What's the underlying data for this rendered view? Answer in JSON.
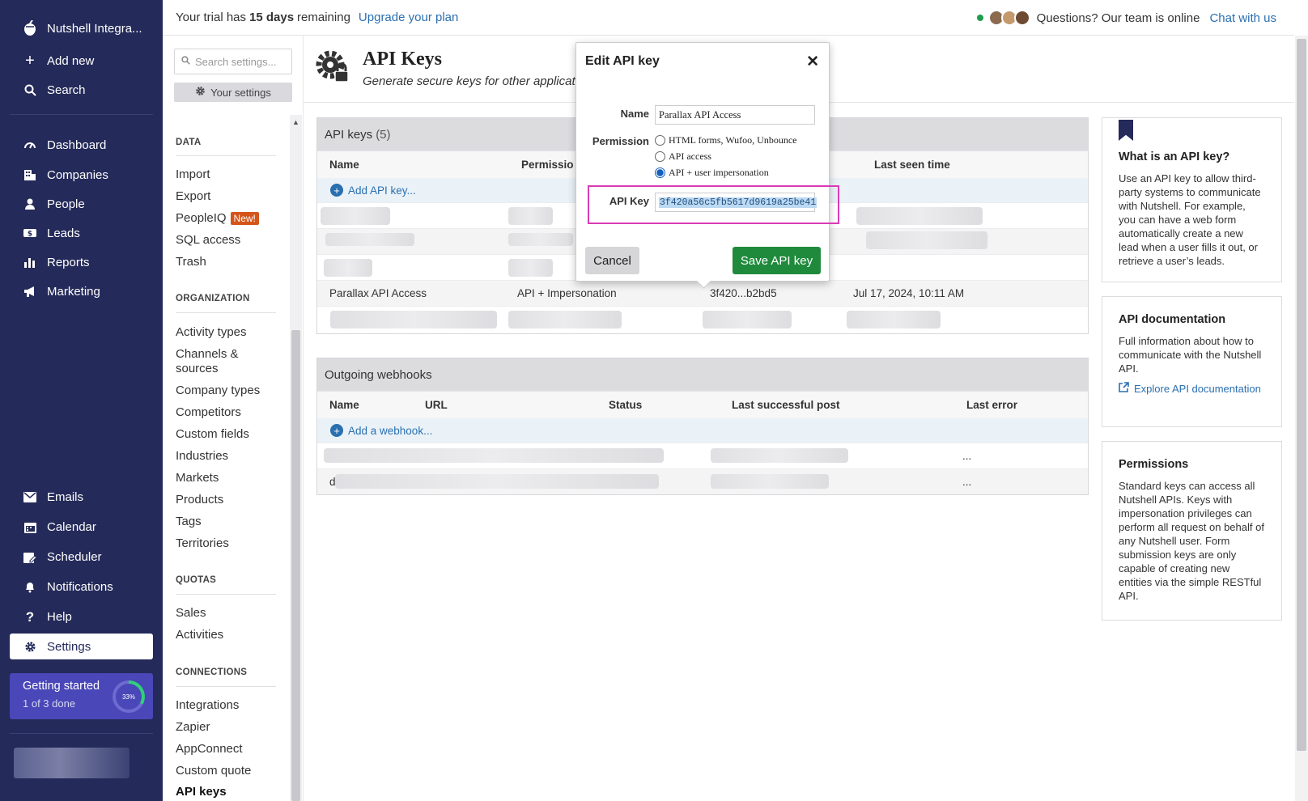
{
  "app": {
    "workspace_name": "Nutshell Integra..."
  },
  "nav": {
    "add_new": "Add new",
    "search": "Search",
    "dashboard": "Dashboard",
    "companies": "Companies",
    "people": "People",
    "leads": "Leads",
    "reports": "Reports",
    "marketing": "Marketing",
    "emails": "Emails",
    "calendar": "Calendar",
    "scheduler": "Scheduler",
    "notifications": "Notifications",
    "help": "Help",
    "settings": "Settings"
  },
  "getting_started": {
    "title": "Getting started",
    "progress_text": "1 of 3 done",
    "percent_label": "33%",
    "percent": 33
  },
  "topbar": {
    "trial_prefix": "Your trial has",
    "trial_days": "15 days",
    "trial_suffix": "remaining",
    "upgrade_link": "Upgrade your plan",
    "support_text": "Questions? Our team is online",
    "chat_link": "Chat with us"
  },
  "settings_sidebar": {
    "search_placeholder": "Search settings...",
    "your_settings": "Your settings",
    "data_heading": "DATA",
    "data_items": [
      "Import",
      "Export",
      "PeopleIQ",
      "SQL access",
      "Trash"
    ],
    "new_badge": "New!",
    "org_heading": "ORGANIZATION",
    "org_items": [
      "Activity types",
      "Channels &",
      "sources",
      "Company types",
      "Competitors",
      "Custom fields",
      "Industries",
      "Markets",
      "Products",
      "Tags",
      "Territories"
    ],
    "quotas_heading": "QUOTAS",
    "quotas_items": [
      "Sales",
      "Activities"
    ],
    "connections_heading": "CONNECTIONS",
    "connections_items": [
      "Integrations",
      "Zapier",
      "AppConnect",
      "Custom quote",
      "API keys"
    ]
  },
  "page": {
    "title": "API Keys",
    "subtitle": "Generate secure keys for other applications"
  },
  "api_keys_panel": {
    "title": "API keys",
    "count": "(5)",
    "columns": {
      "name": "Name",
      "permission": "Permissio",
      "last_seen": "Last seen time"
    },
    "add_label": "Add API key...",
    "row": {
      "name": "Parallax API Access",
      "permission": "API + Impersonation",
      "key": "3f420...b2bd5",
      "last_seen": "Jul 17, 2024, 10:11 AM"
    }
  },
  "webhooks_panel": {
    "title": "Outgoing webhooks",
    "columns": {
      "name": "Name",
      "url": "URL",
      "status": "Status",
      "last_post": "Last successful post",
      "last_error": "Last error"
    },
    "add_label": "Add a webhook...",
    "row1_error": "...",
    "row2_name": "d",
    "row2_error": "..."
  },
  "aside": {
    "what_title": "What is an API key?",
    "what_body": "Use an API key to allow third-party systems to communicate with Nutshell. For example, you can have a web form automatically create a new lead when a user fills it out, or retrieve a user’s leads.",
    "doc_title": "API documentation",
    "doc_body": "Full information about how to communicate with the Nutshell API.",
    "doc_link": "Explore API documentation",
    "perm_title": "Permissions",
    "perm_body": "Standard keys can access all Nutshell APIs. Keys with impersonation privileges can perform all request on behalf of any Nutshell user. Form submission keys are only capable of creating new entities via the simple RESTful API."
  },
  "modal": {
    "title": "Edit API key",
    "name_label": "Name",
    "name_value": "Parallax API Access",
    "permission_label": "Permission",
    "options": [
      "HTML forms, Wufoo, Unbounce",
      "API access",
      "API + user impersonation"
    ],
    "selected_option": "API + user impersonation",
    "key_label": "API Key",
    "key_value": "3f420a56c5fb5617d9619a25be41",
    "cancel": "Cancel",
    "save": "Save API key"
  },
  "colors": {
    "nav_bg": "#242a59",
    "accent_link": "#2a6fb0",
    "save_green": "#1f8a3c",
    "highlight_magenta": "#d93bb5",
    "new_badge": "#d4541a"
  }
}
